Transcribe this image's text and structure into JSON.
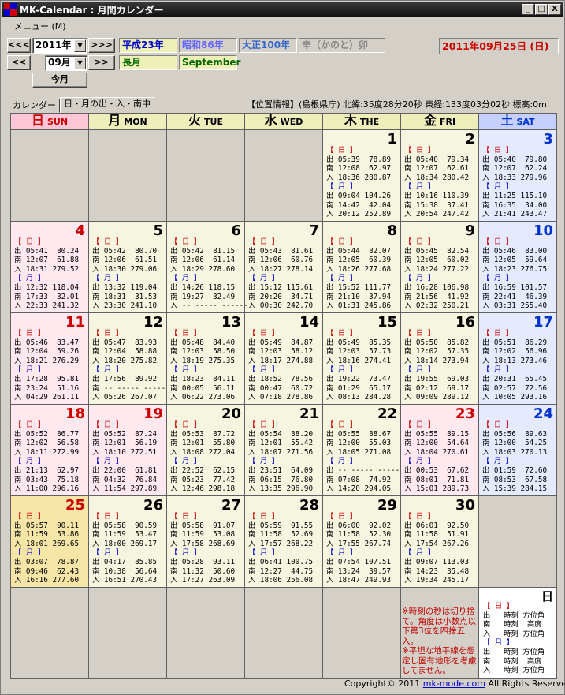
{
  "window": {
    "title": "MK-Calendar : 月間カレンダー",
    "min": "_",
    "max": "□",
    "close": "X"
  },
  "menu": {
    "item": "メニュー (M)"
  },
  "nav": {
    "prev_year": "<<<",
    "next_year": ">>>",
    "prev_month": "<<",
    "next_month": ">>",
    "year": "2011年",
    "month": "09月",
    "today": "今月"
  },
  "eras": {
    "heisei": "平成23年",
    "showa": "昭和86年",
    "taisho": "大正100年",
    "eto": "辛（かのと）卯",
    "kyu_month": "長月",
    "en_month": "September",
    "today_date": "2011年09月25日 (日)"
  },
  "tabs": [
    {
      "label": "カレンダー"
    },
    {
      "label": "日・月の出・入・南中"
    }
  ],
  "location": "【位置情報】(島根県庁) 北緯:35度28分20秒 東経:133度03分02秒 標高:0m",
  "weekdays": [
    {
      "jp": "日",
      "en": "SUN"
    },
    {
      "jp": "月",
      "en": "MON"
    },
    {
      "jp": "火",
      "en": "TUE"
    },
    {
      "jp": "水",
      "en": "WED"
    },
    {
      "jp": "木",
      "en": "THE"
    },
    {
      "jp": "金",
      "en": "FRI"
    },
    {
      "jp": "土",
      "en": "SAT"
    }
  ],
  "colors": {
    "sun": "#cc0000",
    "sat": "#0033cc",
    "weekday": "#000000",
    "sun_bg": "#ffe8ee",
    "sat_bg": "#e6eaff",
    "wk_bg": "#f5f5e0",
    "empty_bg": "#d4d0c8",
    "today_bg": "#f5e6a8"
  },
  "days": [
    {
      "n": "",
      "e": 1
    },
    {
      "n": "",
      "e": 1
    },
    {
      "n": "",
      "e": 1
    },
    {
      "n": "",
      "e": 1
    },
    {
      "n": "1",
      "t": "【 日 】\n出 05:39  78.89\n南 12:08  62.97\n入 18:36 280.87\n【 月 】\n出 09:04 104.26\n南 14:42  42.04\n入 20:12 252.89"
    },
    {
      "n": "2",
      "t": "【 日 】\n出 05:40  79.34\n南 12:07  62.61\n入 18:34 280.42\n【 月 】\n出 10:16 110.39\n南 15:38  37.41\n入 20:54 247.42"
    },
    {
      "n": "3",
      "t": "【 日 】\n出 05:40  79.80\n南 12:07  62.24\n入 18:33 279.96\n【 月 】\n出 11:25 115.10\n南 16:35  34.00\n入 21:41 243.47"
    },
    {
      "n": "4",
      "t": "【 日 】\n出 05:41  80.24\n南 12:07  61.88\n入 18:31 279.52\n【 月 】\n出 12:32 118.04\n南 17:33  32.01\n入 22:33 241.32"
    },
    {
      "n": "5",
      "t": "【 日 】\n出 05:42  80.70\n南 12:06  61.51\n入 18:30 279.06\n【 月 】\n出 13:32 119.04\n南 18:31  31.53\n入 23:30 241.10"
    },
    {
      "n": "6",
      "t": "【 日 】\n出 05:42  81.15\n南 12:06  61.14\n入 18:29 278.60\n【 月 】\n出 14:26 118.15\n南 19:27  32.49\n入 -- ----- ------"
    },
    {
      "n": "7",
      "t": "【 日 】\n出 05:43  81.61\n南 12:06  60.76\n入 18:27 278.14\n【 月 】\n出 15:12 115.61\n南 20:20  34.71\n入 00:30 242.70"
    },
    {
      "n": "8",
      "t": "【 日 】\n出 05:44  82.07\n南 12:05  60.39\n入 18:26 277.68\n【 月 】\n出 15:52 111.77\n南 21:10  37.94\n入 01:31 245.86"
    },
    {
      "n": "9",
      "t": "【 日 】\n出 05:45  82.54\n南 12:05  60.02\n入 18:24 277.22\n【 月 】\n出 16:28 106.98\n南 21:56  41.92\n入 02:32 250.21"
    },
    {
      "n": "10",
      "t": "【 日 】\n出 05:46  83.00\n南 12:05  59.64\n入 18:23 276.75\n【 月 】\n出 16:59 101.57\n南 22:41  46.39\n入 03:31 255.40"
    },
    {
      "n": "11",
      "t": "【 日 】\n出 05:46  83.47\n南 12:04  59.26\n入 18:21 276.29\n【 月 】\n出 17:28  95.81\n南 23:24  51.16\n入 04:29 261.11"
    },
    {
      "n": "12",
      "t": "【 日 】\n出 05:47  83.93\n南 12:04  58.88\n入 18:20 275.82\n【 月 】\n出 17:56  89.92\n南 -- ----- -----\n入 05:26 267.07"
    },
    {
      "n": "13",
      "t": "【 日 】\n出 05:48  84.40\n南 12:03  58.50\n入 18:19 275.35\n【 月 】\n出 18:23  84.11\n南 00:05  56.11\n入 06:22 273.06"
    },
    {
      "n": "14",
      "t": "【 日 】\n出 05:49  84.87\n南 12:03  58.12\n入 18:17 274.88\n【 月 】\n出 18:52  78.56\n南 00:47  60.72\n入 07:18 278.86"
    },
    {
      "n": "15",
      "t": "【 日 】\n出 05:49  85.35\n南 12:03  57.73\n入 18:16 274.41\n【 月 】\n出 19:22  73.47\n南 01:29  65.17\n入 08:13 284.28"
    },
    {
      "n": "16",
      "t": "【 日 】\n出 05:50  85.82\n南 12:02  57.35\n入 18:14 273.94\n【 月 】\n出 19:55  69.03\n南 02:12  69.17\n入 09:09 289.12"
    },
    {
      "n": "17",
      "t": "【 日 】\n出 05:51  86.29\n南 12:02  56.96\n入 18:13 273.46\n【 月 】\n出 20:31  65.45\n南 02:57  72.56\n入 10:05 293.16"
    },
    {
      "n": "18",
      "t": "【 日 】\n出 05:52  86.77\n南 12:02  56.58\n入 18:11 272.99\n【 月 】\n出 21:13  62.97\n南 03:43  75.18\n入 11:00 296.16"
    },
    {
      "n": "19",
      "hol": 1,
      "t": "【 日 】\n出 05:52  87.24\n南 12:01  56.19\n入 18:10 272.51\n【 月 】\n出 22:00  61.81\n南 04:32  76.84\n入 11:54 297.89"
    },
    {
      "n": "20",
      "t": "【 日 】\n出 05:53  87.72\n南 12:01  55.80\n入 18:08 272.04\n【 月 】\n出 22:52  62.15\n南 05:23  77.42\n入 12:46 298.18"
    },
    {
      "n": "21",
      "t": "【 日 】\n出 05:54  88.20\n南 12:01  55.42\n入 18:07 271.56\n【 月 】\n出 23:51  64.09\n南 06:15  76.80\n入 13:35 296.90"
    },
    {
      "n": "22",
      "t": "【 日 】\n出 05:55  88.67\n南 12:00  55.03\n入 18:05 271.08\n【 月 】\n出 -- ----- -----\n南 07:08  74.92\n入 14:20 294.05"
    },
    {
      "n": "23",
      "hol": 1,
      "t": "【 日 】\n出 05:55  89.15\n南 12:00  54.64\n入 18:04 270.61\n【 月 】\n出 00:53  67.62\n南 08:01  71.81\n入 15:01 289.73"
    },
    {
      "n": "24",
      "t": "【 日 】\n出 05:56  89.63\n南 12:00  54.25\n入 18:03 270.13\n【 月 】\n出 01:59  72.60\n南 08:53  67.58\n入 15:39 284.15"
    },
    {
      "n": "25",
      "today": 1,
      "t": "【 日 】\n出 05:57  90.11\n南 11:59  53.86\n入 18:01 269.65\n【 月 】\n出 03:07  78.87\n南 09:46  62.43\n入 16:16 277.60"
    },
    {
      "n": "26",
      "t": "【 日 】\n出 05:58  90.59\n南 11:59  53.47\n入 18:00 269.17\n【 月 】\n出 04:17  85.85\n南 10:38  56.64\n入 16:51 270.43"
    },
    {
      "n": "27",
      "t": "【 日 】\n出 05:58  91.07\n南 11:59  53.08\n入 17:58 268.69\n【 月 】\n出 05:28  93.11\n南 11:32  50.60\n入 17:27 263.09"
    },
    {
      "n": "28",
      "t": "【 日 】\n出 05:59  91.55\n南 11:58  52.69\n入 17:57 268.22\n【 月 】\n出 06:41 100.75\n南 12:27  44.75\n入 18:06 256.08"
    },
    {
      "n": "29",
      "t": "【 日 】\n出 06:00  92.02\n南 11:58  52.30\n入 17:55 267.74\n【 月 】\n出 07:54 107.51\n南 13:24  39.57\n入 18:47 249.93"
    },
    {
      "n": "30",
      "t": "【 日 】\n出 06:01  92.50\n南 11:58  51.91\n入 17:54 267.26\n【 月 】\n出 09:07 113.03\n南 14:23  35.48\n入 19:34 245.17"
    },
    {
      "n": "",
      "e": 1
    },
    {
      "n": "",
      "e": 1
    },
    {
      "n": "",
      "e": 1
    },
    {
      "n": "",
      "e": 1
    },
    {
      "n": "",
      "e": 1
    },
    {
      "n": "",
      "e": 1
    },
    {
      "n": "",
      "e": 1,
      "note": "※時刻の秒は切り捨て。角度は小数点以下第3位を四捨五入。\n※平坦な地平線を想定し固有地形を考慮してません。"
    },
    {
      "n": "日",
      "legend": 1,
      "t": "【 日 】\n出   時刻 方位角\n南   時刻  高度\n入   時刻 方位角\n【 月 】\n出   時刻 方位角\n南   時刻  高度\n入   時刻 方位角"
    }
  ],
  "footer": {
    "copyright": "Copyright© 2011 ",
    "link": "mk-mode.com",
    "rights": " All Rights Reserved."
  },
  "watermark": "©2011 mk-mode.com"
}
